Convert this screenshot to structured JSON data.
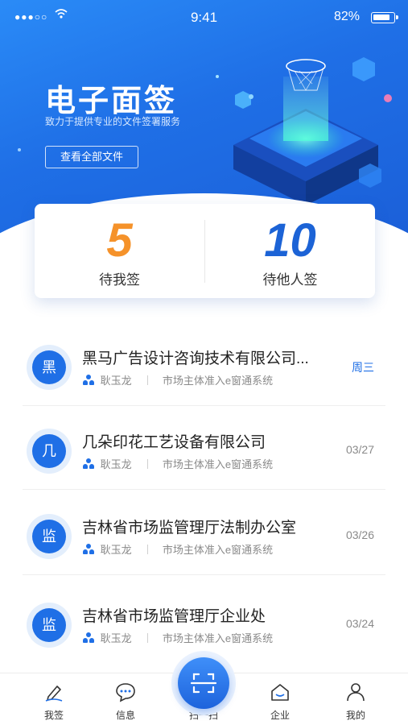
{
  "status_bar": {
    "signal": "●●●○○",
    "time": "9:41",
    "battery": "82%"
  },
  "hero": {
    "title": "电子面签",
    "subtitle": "致力于提供专业的文件签署服务",
    "view_all_button": "查看全部文件"
  },
  "stats": {
    "pending_mine": {
      "count": "5",
      "label": "待我签"
    },
    "pending_others": {
      "count": "10",
      "label": "待他人签"
    }
  },
  "documents": [
    {
      "avatar": "黑",
      "title": "黑马广告设计咨询技术有限公司...",
      "person": "耿玉龙",
      "system": "市场主体准入e窗通系统",
      "date": "周三",
      "highlight": true
    },
    {
      "avatar": "几",
      "title": "几朵印花工艺设备有限公司",
      "person": "耿玉龙",
      "system": "市场主体准入e窗通系统",
      "date": "03/27",
      "highlight": false
    },
    {
      "avatar": "监",
      "title": "吉林省市场监管理厅法制办公室",
      "person": "耿玉龙",
      "system": "市场主体准入e窗通系统",
      "date": "03/26",
      "highlight": false
    },
    {
      "avatar": "监",
      "title": "吉林省市场监管理厅企业处",
      "person": "耿玉龙",
      "system": "市场主体准入e窗通系统",
      "date": "03/24",
      "highlight": false
    }
  ],
  "tabbar": {
    "items": [
      {
        "label": "我签",
        "icon": "pen-icon"
      },
      {
        "label": "信息",
        "icon": "chat-icon"
      },
      {
        "label": "扫一扫",
        "icon": "scan-icon"
      },
      {
        "label": "企业",
        "icon": "home-icon"
      },
      {
        "label": "我的",
        "icon": "user-icon"
      }
    ]
  },
  "colors": {
    "primary": "#1f6fe6",
    "accent_orange": "#f5922a",
    "date_highlight": "#1f6fe6"
  }
}
